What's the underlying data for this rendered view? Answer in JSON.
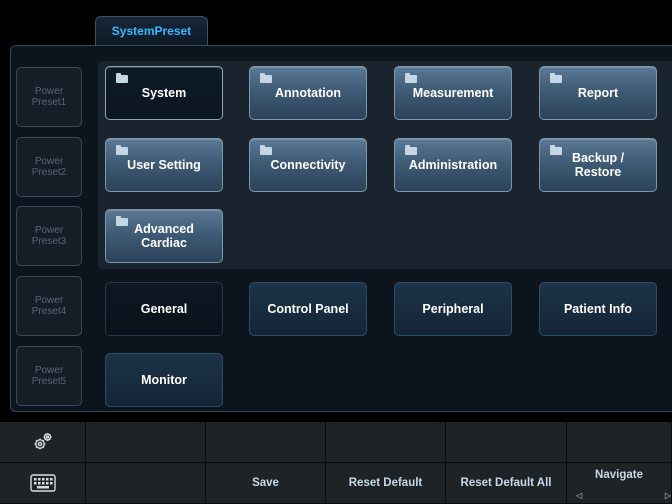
{
  "tab": {
    "label": "SystemPreset"
  },
  "power_presets": [
    {
      "line1": "Power",
      "line2": "Preset1"
    },
    {
      "line1": "Power",
      "line2": "Preset2"
    },
    {
      "line1": "Power",
      "line2": "Preset3"
    },
    {
      "line1": "Power",
      "line2": "Preset4"
    },
    {
      "line1": "Power",
      "line2": "Preset5"
    }
  ],
  "folders": {
    "system": "System",
    "annotation": "Annotation",
    "measurement": "Measurement",
    "report": "Report",
    "user_setting": "User Setting",
    "connectivity": "Connectivity",
    "administration": "Administration",
    "backup_restore_1": "Backup /",
    "backup_restore_2": "Restore",
    "advanced_cardiac_1": "Advanced",
    "advanced_cardiac_2": "Cardiac"
  },
  "pages": {
    "general": "General",
    "control_panel": "Control Panel",
    "peripheral": "Peripheral",
    "patient_info": "Patient Info",
    "monitor": "Monitor"
  },
  "softkeys": {
    "save": "Save",
    "reset_default": "Reset Default",
    "reset_default_all": "Reset Default All",
    "navigate": "Navigate",
    "nav_left": "◁",
    "nav_right": "▷"
  },
  "icons": {
    "settings": "gears-icon",
    "keyboard": "keyboard-icon"
  }
}
